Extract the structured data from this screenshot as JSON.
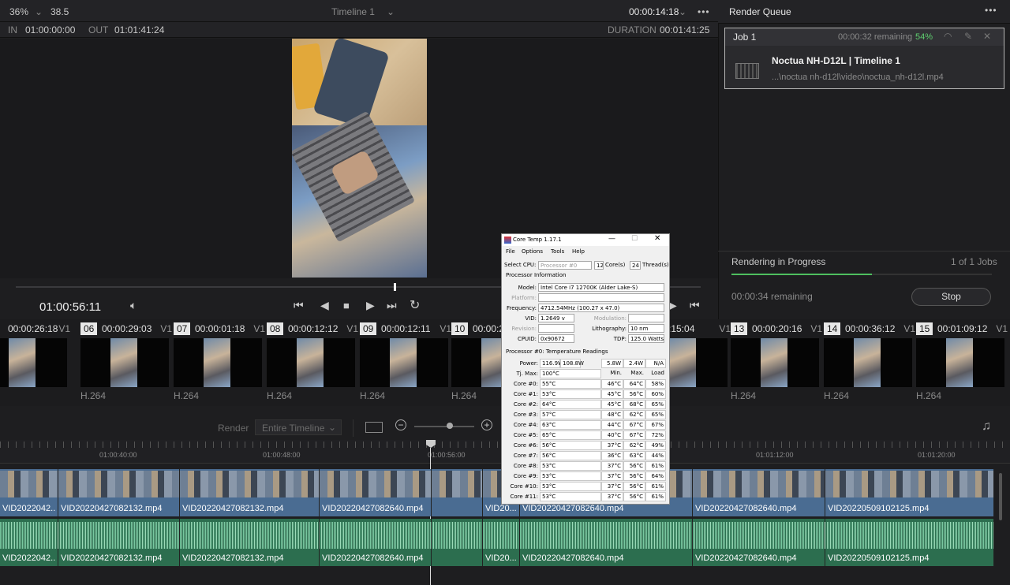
{
  "viewer": {
    "zoom": "36%",
    "fps": "38.5",
    "timeline_name": "Timeline 1",
    "timecode_top": "00:00:14:18",
    "in_label": "IN",
    "in_value": "01:00:00:00",
    "out_label": "OUT",
    "out_value": "01:01:41:24",
    "duration_label": "DURATION",
    "duration_value": "00:01:41:25",
    "current_time": "01:00:56:11"
  },
  "render_queue": {
    "title": "Render Queue",
    "job": {
      "name": "Job 1",
      "remaining": "00:00:32 remaining",
      "percent": "54%",
      "title": "Noctua NH-D12L | Timeline 1",
      "path": "...\\noctua nh-d12l\\video\\noctua_nh-d12l.mp4"
    },
    "status": "Rendering in Progress",
    "jobs_count": "1 of 1 Jobs",
    "progress_fraction": 0.54,
    "remaining_bottom": "00:00:34 remaining",
    "stop_label": "Stop"
  },
  "clips": [
    {
      "num": "",
      "tc": "00:00:26:18",
      "track": "V1",
      "codec": "264"
    },
    {
      "num": "06",
      "tc": "00:00:29:03",
      "track": "V1",
      "codec": "H.264"
    },
    {
      "num": "07",
      "tc": "00:00:01:18",
      "track": "V1",
      "codec": "H.264"
    },
    {
      "num": "08",
      "tc": "00:00:12:12",
      "track": "V1",
      "codec": "H.264"
    },
    {
      "num": "09",
      "tc": "00:00:12:11",
      "track": "V1",
      "codec": "H.264"
    },
    {
      "num": "10",
      "tc": "00:00:2",
      "track": "",
      "codec": "H.264"
    },
    {
      "num": "",
      "tc": ":15:04",
      "track": "V1",
      "codec": "264"
    },
    {
      "num": "13",
      "tc": "00:00:20:16",
      "track": "V1",
      "codec": "H.264"
    },
    {
      "num": "14",
      "tc": "00:00:36:12",
      "track": "V1",
      "codec": "H.264"
    },
    {
      "num": "15",
      "tc": "00:01:09:12",
      "track": "V1",
      "codec": "H.264"
    }
  ],
  "timeline": {
    "render_label": "Render",
    "render_option": "Entire Timeline",
    "ruler": [
      "01:00:40:00",
      "01:00:48:00",
      "01:00:56:00",
      "01:01:12:00",
      "01:01:20:00"
    ],
    "video_clips": [
      "VID2022042...",
      "VID20220427082132.mp4",
      "VID20220427082132.mp4",
      "VID20220427082640.mp4",
      "",
      "VID20...",
      "VID20220427082640.mp4",
      "VID20220427082640.mp4",
      "VID20220509102125.mp4"
    ],
    "audio_clips": [
      "VID2022042...",
      "VID20220427082132.mp4",
      "VID20220427082132.mp4",
      "VID20220427082640.mp4",
      "",
      "VID20...",
      "VID20220427082640.mp4",
      "VID20220427082640.mp4",
      "VID20220509102125.mp4"
    ]
  },
  "coretemp": {
    "title": "Core Temp 1.17.1",
    "menu": [
      "File",
      "Options",
      "Tools",
      "Help"
    ],
    "select_cpu_label": "Select CPU:",
    "select_cpu_value": "Processor #0",
    "cores": "12",
    "cores_label": "Core(s)",
    "threads": "24",
    "threads_label": "Thread(s)",
    "proc_info_label": "Processor Information",
    "model_label": "Model:",
    "model": "Intel Core i7 12700K (Alder Lake-S)",
    "platform_label": "Platform:",
    "frequency_label": "Frequency:",
    "frequency": "4712.54MHz (100.27 x 47.0)",
    "vid_label": "VID:",
    "vid": "1.2649 v",
    "modulation_label": "Modulation:",
    "revision_label": "Revision:",
    "lithography_label": "Lithography:",
    "lithography": "10 nm",
    "cpuid_label": "CPUID:",
    "cpuid": "0x90672",
    "tdp_label": "TDP:",
    "tdp": "125.0 Watts",
    "temp_label": "Processor #0: Temperature Readings",
    "power_label": "Power:",
    "power": [
      "116.9W",
      "108.8W",
      "5.8W",
      "2.4W",
      "N/A"
    ],
    "tjmax_label": "Tj. Max:",
    "tjmax": "100°C",
    "min_label": "Min.",
    "max_label": "Max.",
    "load_label": "Load",
    "cores_rows": [
      {
        "name": "Core #0:",
        "t": "55°C",
        "min": "46°C",
        "max": "64°C",
        "load": "58%"
      },
      {
        "name": "Core #1:",
        "t": "53°C",
        "min": "45°C",
        "max": "56°C",
        "load": "60%"
      },
      {
        "name": "Core #2:",
        "t": "64°C",
        "min": "45°C",
        "max": "68°C",
        "load": "65%"
      },
      {
        "name": "Core #3:",
        "t": "57°C",
        "min": "48°C",
        "max": "62°C",
        "load": "65%"
      },
      {
        "name": "Core #4:",
        "t": "63°C",
        "min": "44°C",
        "max": "67°C",
        "load": "67%"
      },
      {
        "name": "Core #5:",
        "t": "65°C",
        "min": "40°C",
        "max": "67°C",
        "load": "72%"
      },
      {
        "name": "Core #6:",
        "t": "56°C",
        "min": "37°C",
        "max": "62°C",
        "load": "49%"
      },
      {
        "name": "Core #7:",
        "t": "56°C",
        "min": "36°C",
        "max": "63°C",
        "load": "44%"
      },
      {
        "name": "Core #8:",
        "t": "53°C",
        "min": "37°C",
        "max": "56°C",
        "load": "61%"
      },
      {
        "name": "Core #9:",
        "t": "53°C",
        "min": "37°C",
        "max": "56°C",
        "load": "64%"
      },
      {
        "name": "Core #10:",
        "t": "53°C",
        "min": "37°C",
        "max": "56°C",
        "load": "61%"
      },
      {
        "name": "Core #11:",
        "t": "53°C",
        "min": "37°C",
        "max": "56°C",
        "load": "61%"
      }
    ]
  }
}
